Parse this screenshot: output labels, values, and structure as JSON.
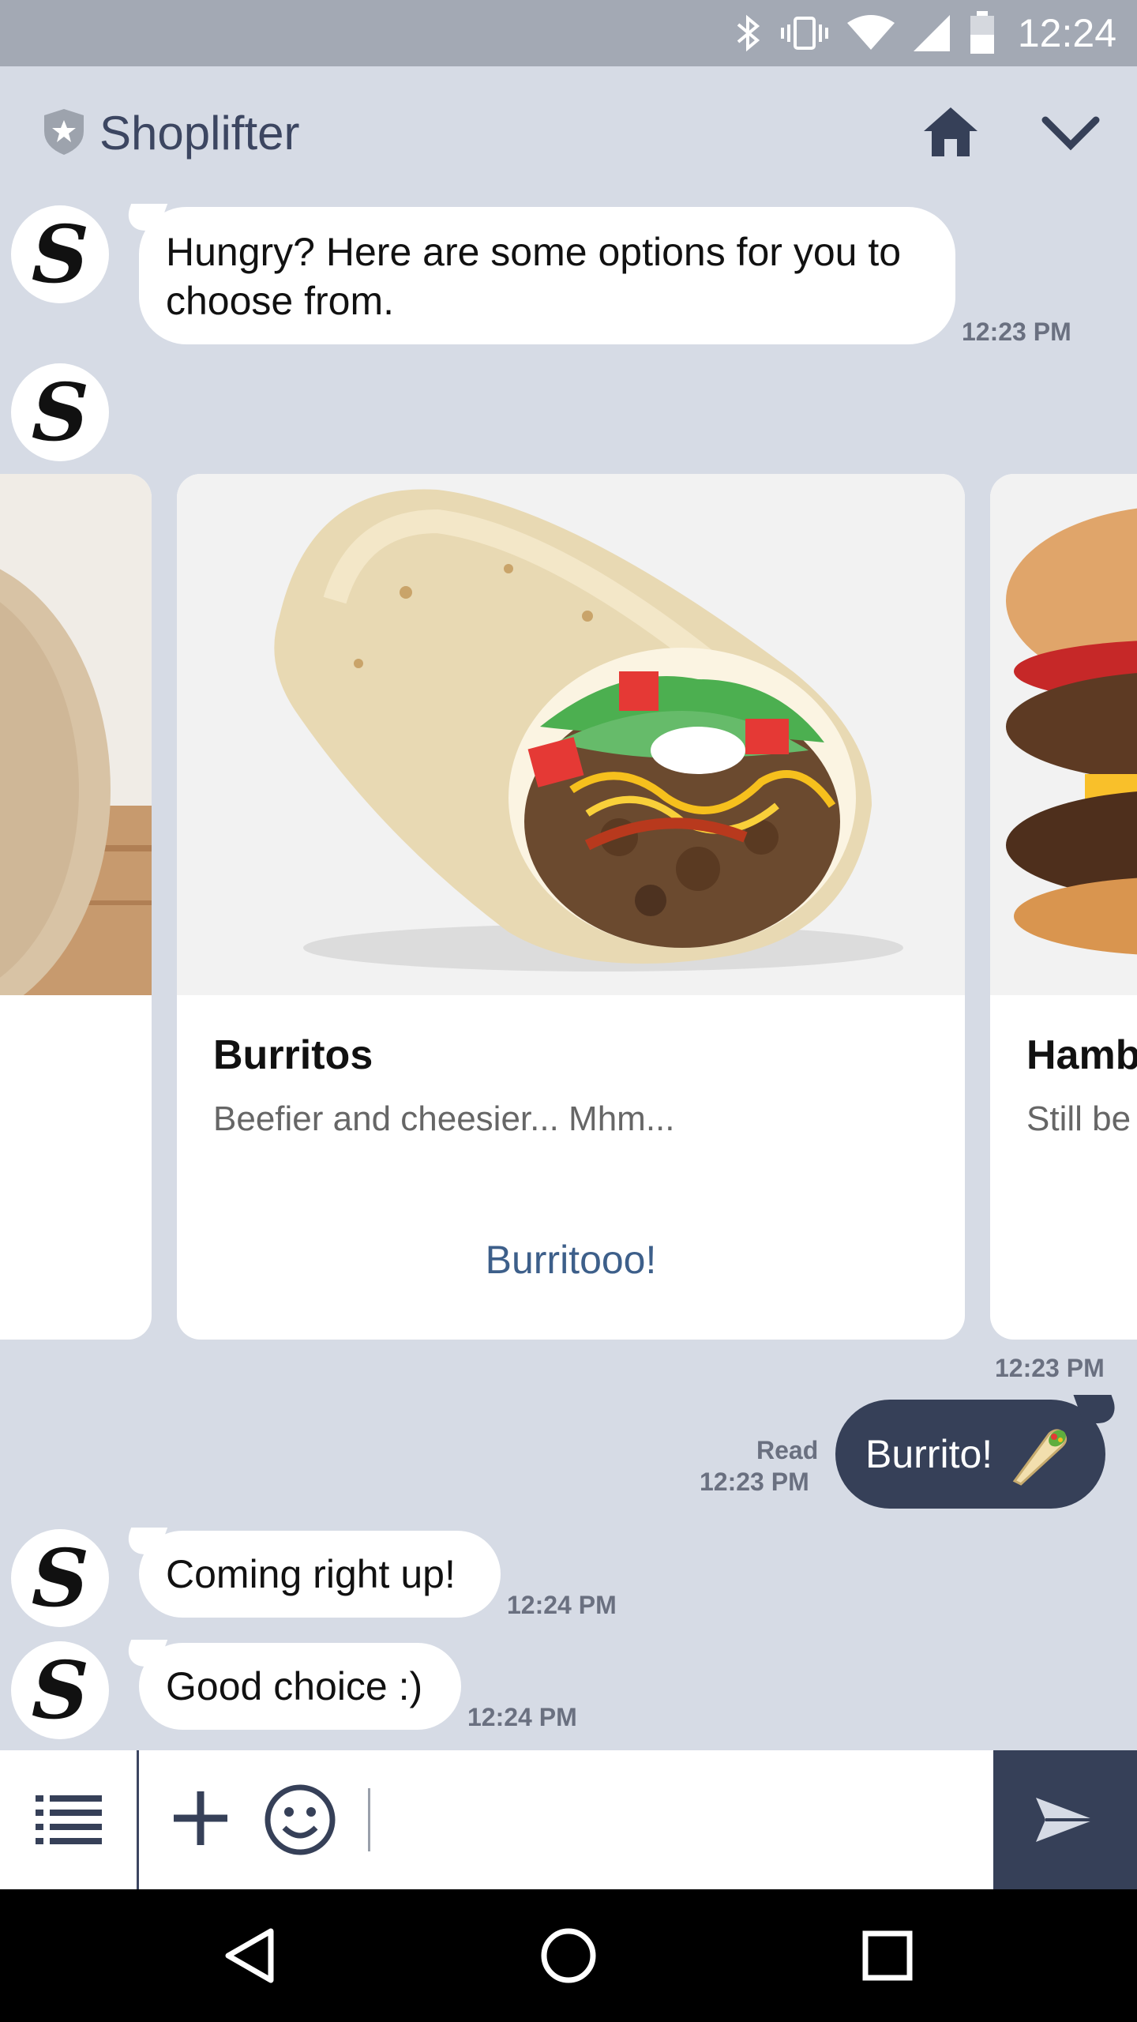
{
  "status_bar": {
    "time": "12:24"
  },
  "header": {
    "title": "Shoplifter"
  },
  "messages": {
    "intro": {
      "text": "Hungry? Here are some options for you to choose from.",
      "time": "12:23 PM"
    },
    "carousel_time": "12:23 PM",
    "user_reply": {
      "text": "Burrito!",
      "status": "Read",
      "time": "12:23 PM"
    },
    "reply1": {
      "text": "Coming right up!",
      "time": "12:24 PM"
    },
    "reply2": {
      "text": "Good choice :)",
      "time": "12:24 PM"
    }
  },
  "carousel": {
    "cards": [
      {
        "title": "Burritos",
        "subtitle": "Beefier and cheesier... Mhm...",
        "action": "Burritooo!"
      },
      {
        "title": "Hamb",
        "subtitle": "Still be"
      }
    ]
  },
  "input": {
    "placeholder": ""
  },
  "colors": {
    "background": "#d6dbe5",
    "accent": "#364058",
    "link": "#3d5f8a"
  }
}
